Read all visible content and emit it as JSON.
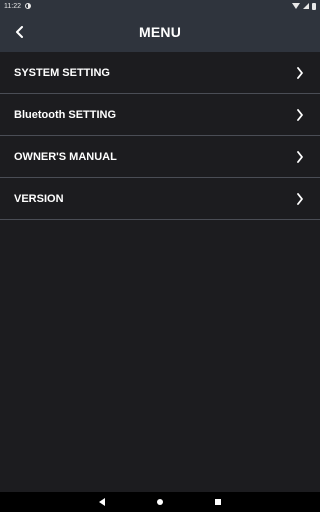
{
  "status_bar": {
    "time": "11:22",
    "icons": [
      "sync-icon",
      "wifi-icon",
      "signal-icon",
      "battery-icon"
    ]
  },
  "header": {
    "title": "MENU",
    "back_icon": "chevron-left-icon"
  },
  "menu": {
    "items": [
      {
        "label": "SYSTEM SETTING",
        "icon": "chevron-right-icon"
      },
      {
        "label": "Bluetooth SETTING",
        "icon": "chevron-right-icon"
      },
      {
        "label": "OWNER'S MANUAL",
        "icon": "chevron-right-icon"
      },
      {
        "label": "VERSION",
        "icon": "chevron-right-icon"
      }
    ]
  },
  "nav_bar": {
    "buttons": [
      "back-triangle-icon",
      "home-circle-icon",
      "recents-square-icon"
    ]
  },
  "colors": {
    "header_bg": "#2f343d",
    "body_bg": "#1c1c1f",
    "divider": "#4a4d55",
    "text": "#ffffff",
    "nav_bg": "#000000"
  }
}
